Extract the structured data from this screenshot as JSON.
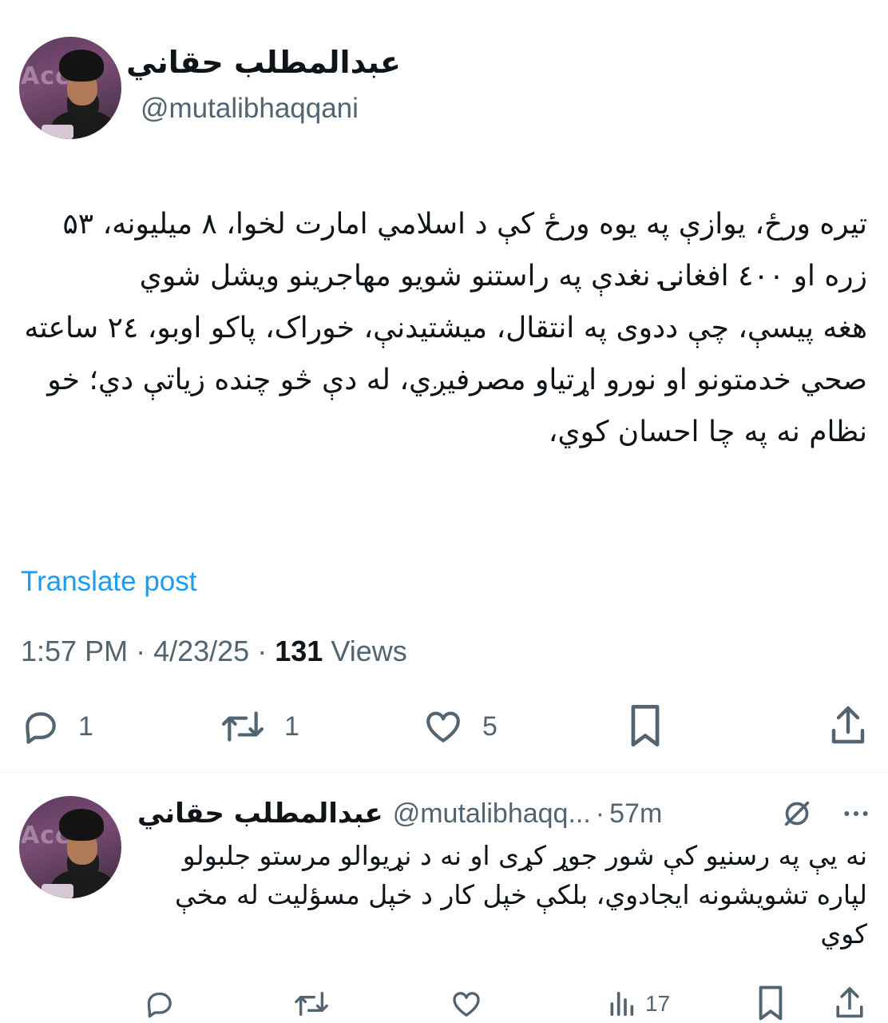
{
  "main_tweet": {
    "author": {
      "display_name": "عبدالمطلب حقاني",
      "handle": "@mutalibhaqqani",
      "avatar_bg_text": "Acc"
    },
    "text_paragraphs": [
      "تیره ورځ، یوازې په یوه ورځ کې د اسلامي امارت لخوا، ۸ میلیونه، ۵۳ زره او ٤۰۰ افغانۍ نغدې په راستنو شویو مهاجرینو ویشل شوي",
      "هغه پیسې، چې ددوی په انتقال، میشتیدنې، خوراک، پاکو اوبو، ۲٤ ساعته صحي خدمتونو او نورو اړتیاو مصرفیږي، له دې څو چنده زیاتې دي؛ خو نظام نه په چا احسان کوي،"
    ],
    "translate_label": "Translate post",
    "time": "1:57 PM",
    "date": "4/23/25",
    "views_count": "131",
    "views_label": "Views",
    "actions": {
      "reply_count": "1",
      "retweet_count": "1",
      "like_count": "5"
    }
  },
  "reply_tweet": {
    "author": {
      "display_name": "عبدالمطلب حقاني",
      "handle": "@mutalibhaqq...",
      "avatar_bg_text": "Acc"
    },
    "time_ago": "57m",
    "text": "نه یې په رسنیو کې شور جوړ کړی او نه د نړیوالو مرستو جلبولو لپاره تشویشونه ایجادوي، بلکې خپل کار د خپل مسؤلیت له مخې کوي",
    "actions": {
      "views_count": "17"
    }
  },
  "icons": {
    "reply": "comment-bubble-icon",
    "retweet": "retweet-icon",
    "like": "heart-icon",
    "bookmark": "bookmark-icon",
    "share": "share-icon",
    "views": "analytics-bars-icon",
    "grok": "slashed-circle-icon",
    "more": "more-dots-icon"
  },
  "colors": {
    "link": "#1d9bf0",
    "secondary_text": "#536471",
    "primary_text": "#0f1419"
  }
}
